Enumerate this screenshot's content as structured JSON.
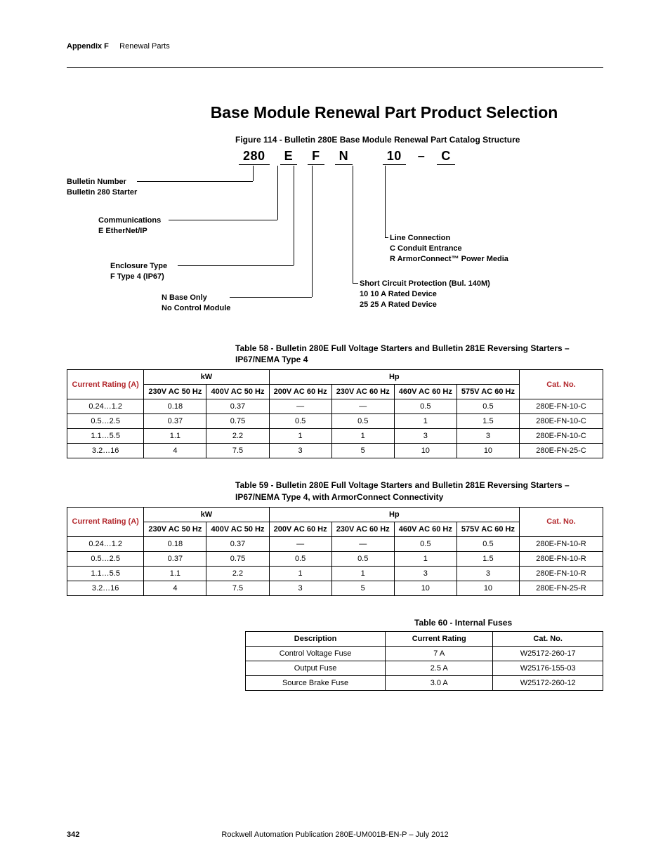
{
  "header": {
    "appendix": "Appendix F",
    "section": "Renewal Parts"
  },
  "title": "Base Module Renewal Part Product Selection",
  "figure_caption": "Figure 114 - Bulletin 280E Base Module Renewal Part Catalog Structure",
  "partnum": {
    "p1": "280",
    "p2": "E",
    "p3": "F",
    "p4": "N",
    "p5": "10",
    "dash": "–",
    "p6": "C"
  },
  "diagram": {
    "bulletin_l1": "Bulletin Number",
    "bulletin_l2": "Bulletin 280 Starter",
    "comm_l1": "Communications",
    "comm_l2": "E EtherNet/IP",
    "enc_l1": "Enclosure Type",
    "enc_l2": "F Type 4 (IP67)",
    "base_l1": "N Base Only",
    "base_l2": "No Control Module",
    "line_l1": "Line Connection",
    "line_l2": "C Conduit Entrance",
    "line_l3": "R ArmorConnect™ Power Media",
    "scp_l1": "Short Circuit Protection (Bul. 140M)",
    "scp_l2": "10 10 A Rated Device",
    "scp_l3": "25 25 A Rated Device"
  },
  "table58": {
    "caption": "Table 58 - Bulletin 280E Full Voltage Starters and Bulletin 281E Reversing Starters – IP67/NEMA Type 4",
    "group_kw": "kW",
    "group_hp": "Hp",
    "col_cr": "Current Rating (A)",
    "col_230_50": "230V AC 50 Hz",
    "col_400_50": "400V AC 50 Hz",
    "col_200_60": "200V AC 60 Hz",
    "col_230_60": "230V AC 60 Hz",
    "col_460_60": "460V AC 60 Hz",
    "col_575_60": "575V AC 60 Hz",
    "col_cat": "Cat. No.",
    "rows": [
      {
        "cr": "0.24…1.2",
        "a": "0.18",
        "b": "0.37",
        "c": "—",
        "d": "—",
        "e": "0.5",
        "f": "0.5",
        "cat": "280E-FN-10-C"
      },
      {
        "cr": "0.5…2.5",
        "a": "0.37",
        "b": "0.75",
        "c": "0.5",
        "d": "0.5",
        "e": "1",
        "f": "1.5",
        "cat": "280E-FN-10-C"
      },
      {
        "cr": "1.1…5.5",
        "a": "1.1",
        "b": "2.2",
        "c": "1",
        "d": "1",
        "e": "3",
        "f": "3",
        "cat": "280E-FN-10-C"
      },
      {
        "cr": "3.2…16",
        "a": "4",
        "b": "7.5",
        "c": "3",
        "d": "5",
        "e": "10",
        "f": "10",
        "cat": "280E-FN-25-C"
      }
    ]
  },
  "table59": {
    "caption": "Table 59 - Bulletin 280E Full Voltage Starters and Bulletin 281E Reversing Starters – IP67/NEMA Type 4, with ArmorConnect Connectivity",
    "rows": [
      {
        "cr": "0.24…1.2",
        "a": "0.18",
        "b": "0.37",
        "c": "—",
        "d": "—",
        "e": "0.5",
        "f": "0.5",
        "cat": "280E-FN-10-R"
      },
      {
        "cr": "0.5…2.5",
        "a": "0.37",
        "b": "0.75",
        "c": "0.5",
        "d": "0.5",
        "e": "1",
        "f": "1.5",
        "cat": "280E-FN-10-R"
      },
      {
        "cr": "1.1…5.5",
        "a": "1.1",
        "b": "2.2",
        "c": "1",
        "d": "1",
        "e": "3",
        "f": "3",
        "cat": "280E-FN-10-R"
      },
      {
        "cr": "3.2…16",
        "a": "4",
        "b": "7.5",
        "c": "3",
        "d": "5",
        "e": "10",
        "f": "10",
        "cat": "280E-FN-25-R"
      }
    ]
  },
  "table60": {
    "caption": "Table 60 - Internal Fuses",
    "col_desc": "Description",
    "col_cr": "Current Rating",
    "col_cat": "Cat. No.",
    "rows": [
      {
        "d": "Control Voltage Fuse",
        "c": "7 A",
        "cat": "W25172-260-17"
      },
      {
        "d": "Output Fuse",
        "c": "2.5 A",
        "cat": "W25176-155-03"
      },
      {
        "d": "Source Brake Fuse",
        "c": "3.0 A",
        "cat": "W25172-260-12"
      }
    ]
  },
  "footer": {
    "page": "342",
    "pub": "Rockwell Automation Publication 280E-UM001B-EN-P – July 2012"
  },
  "chart_data": {
    "type": "table",
    "tables": [
      {
        "name": "Bulletin 280E/281E IP67/NEMA Type 4",
        "columns": [
          "Current Rating (A)",
          "230V AC 50 Hz kW",
          "400V AC 50 Hz kW",
          "200V AC 60 Hz Hp",
          "230V AC 60 Hz Hp",
          "460V AC 60 Hz Hp",
          "575V AC 60 Hz Hp",
          "Cat. No."
        ],
        "rows": [
          [
            "0.24…1.2",
            0.18,
            0.37,
            null,
            null,
            0.5,
            0.5,
            "280E-FN-10-C"
          ],
          [
            "0.5…2.5",
            0.37,
            0.75,
            0.5,
            0.5,
            1,
            1.5,
            "280E-FN-10-C"
          ],
          [
            "1.1…5.5",
            1.1,
            2.2,
            1,
            1,
            3,
            3,
            "280E-FN-10-C"
          ],
          [
            "3.2…16",
            4,
            7.5,
            3,
            5,
            10,
            10,
            "280E-FN-25-C"
          ]
        ]
      },
      {
        "name": "Bulletin 280E/281E IP67/NEMA Type 4 ArmorConnect",
        "columns": [
          "Current Rating (A)",
          "230V AC 50 Hz kW",
          "400V AC 50 Hz kW",
          "200V AC 60 Hz Hp",
          "230V AC 60 Hz Hp",
          "460V AC 60 Hz Hp",
          "575V AC 60 Hz Hp",
          "Cat. No."
        ],
        "rows": [
          [
            "0.24…1.2",
            0.18,
            0.37,
            null,
            null,
            0.5,
            0.5,
            "280E-FN-10-R"
          ],
          [
            "0.5…2.5",
            0.37,
            0.75,
            0.5,
            0.5,
            1,
            1.5,
            "280E-FN-10-R"
          ],
          [
            "1.1…5.5",
            1.1,
            2.2,
            1,
            1,
            3,
            3,
            "280E-FN-10-R"
          ],
          [
            "3.2…16",
            4,
            7.5,
            3,
            5,
            10,
            10,
            "280E-FN-25-R"
          ]
        ]
      },
      {
        "name": "Internal Fuses",
        "columns": [
          "Description",
          "Current Rating",
          "Cat. No."
        ],
        "rows": [
          [
            "Control Voltage Fuse",
            "7 A",
            "W25172-260-17"
          ],
          [
            "Output Fuse",
            "2.5 A",
            "W25176-155-03"
          ],
          [
            "Source Brake Fuse",
            "3.0 A",
            "W25172-260-12"
          ]
        ]
      }
    ]
  }
}
